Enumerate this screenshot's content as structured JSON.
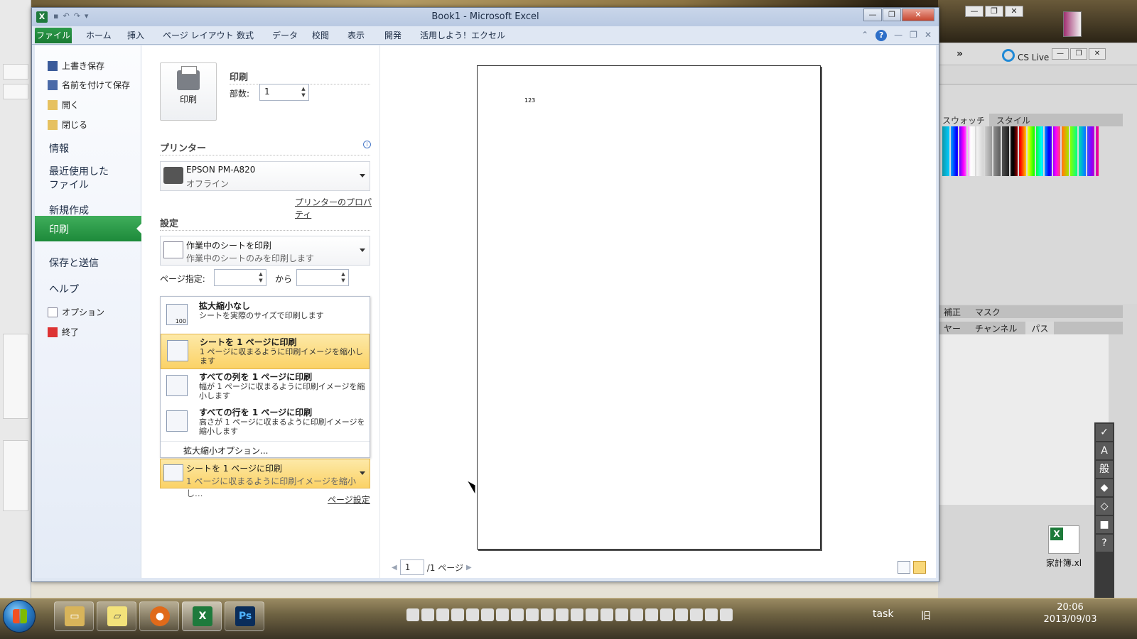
{
  "window": {
    "title": "Book1 - Microsoft Excel",
    "controls": [
      "—",
      "❐",
      "✕"
    ]
  },
  "ribbon": {
    "tabs": [
      "ファイル",
      "ホーム",
      "挿入",
      "ページ レイアウト",
      "数式",
      "データ",
      "校閲",
      "表示",
      "開発",
      "活用しよう！エクセル"
    ]
  },
  "backstage_nav": {
    "small_top": [
      "上書き保存",
      "名前を付けて保存",
      "開く",
      "閉じる"
    ],
    "large": [
      "情報",
      "最近使用した\nファイル",
      "新規作成",
      "印刷",
      "保存と送信",
      "ヘルプ"
    ],
    "active": "印刷",
    "small_bottom": [
      "オプション",
      "終了"
    ]
  },
  "print_panel": {
    "print_button": "印刷",
    "section_print": "印刷",
    "copies_label": "部数:",
    "copies_value": "1",
    "printer_heading": "プリンター",
    "printer_name": "EPSON PM-A820",
    "printer_status": "オフライン",
    "printer_props_link": "プリンターのプロパティ",
    "settings_heading": "設定",
    "what_title": "作業中のシートを印刷",
    "what_desc": "作業中のシートのみを印刷します",
    "pages_label": "ページ指定:",
    "pages_from": "",
    "pages_to_label": "から",
    "pages_to": "",
    "scaling_menu": [
      {
        "title": "拡大縮小なし",
        "desc": "シートを実際のサイズで印刷します",
        "icon": "100"
      },
      {
        "title": "シートを 1 ページに印刷",
        "desc": "1 ページに収まるように印刷イメージを縮小します"
      },
      {
        "title": "すべての列を 1 ページに印刷",
        "desc": "幅が 1 ページに収まるように印刷イメージを縮小します"
      },
      {
        "title": "すべての行を 1 ページに印刷",
        "desc": "高さが 1 ページに収まるように印刷イメージを縮小します"
      }
    ],
    "scaling_options": "拡大縮小オプション...",
    "scaling_selected_title": "シートを 1 ページに印刷",
    "scaling_selected_desc": "1 ページに収まるように印刷イメージを縮小し...",
    "page_setup_link": "ページ設定"
  },
  "preview": {
    "cell_value": "123",
    "page_current": "1",
    "page_total": "/1 ページ"
  },
  "photoshop": {
    "cslive": "CS Live",
    "tab_swatches": "スウォッチ",
    "tab_style": "スタイル",
    "tab_adjust": "補正",
    "tab_mask": "マスク",
    "tab_layer": "ヤー",
    "tab_channel": "チャンネル",
    "tab_path": "パス",
    "file_label": "家計簿.xl"
  },
  "taskbar": {
    "task_label": "task",
    "kyu_label": "旧",
    "time": "20:06",
    "date": "2013/09/03"
  }
}
